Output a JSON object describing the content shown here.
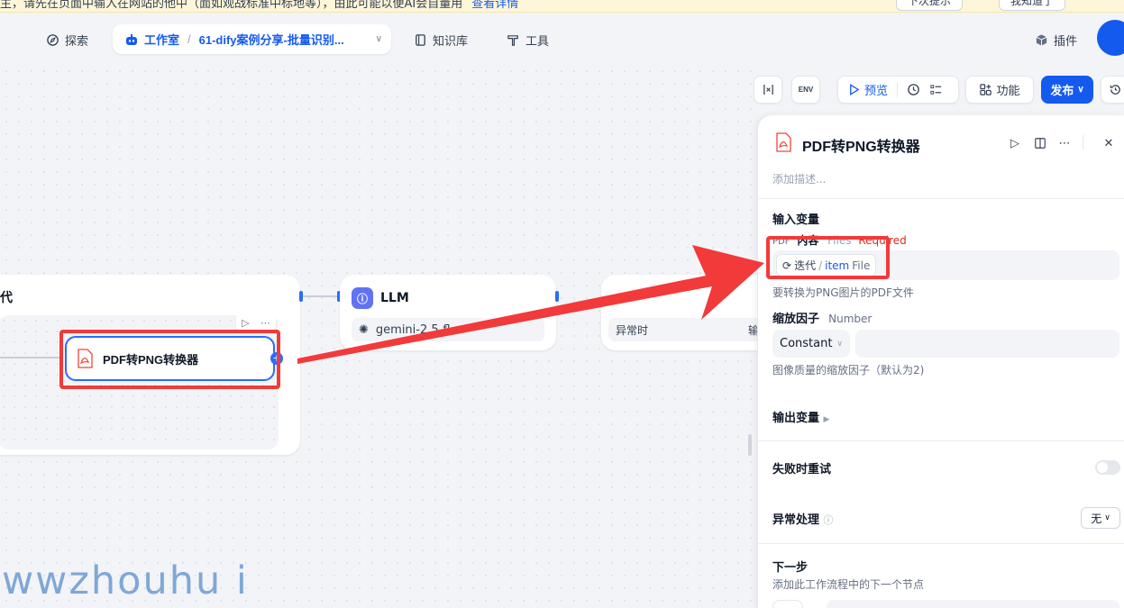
{
  "banner": {
    "text": "主，请先在页面中输入在网站的他中（面如观战标准中标地等），由此可能以便AI会自量用",
    "link": "查看详情",
    "btn1": "下次提示",
    "btn2": "我知道了"
  },
  "nav": {
    "explore": "探索",
    "studio": "工作室",
    "app_name": "61-dify案例分享-批量识别...",
    "knowledge": "知识库",
    "tools": "工具",
    "plugins": "插件"
  },
  "toolbar": {
    "env": "ENV",
    "preview": "预览",
    "features": "功能",
    "publish": "发布"
  },
  "canvas": {
    "iteration_title_fragment": "代",
    "pdf_node_label": "PDF转PNG转换器",
    "llm_title": "LLM",
    "llm_model": "gemini-2.5-fl",
    "node3_row_left": "异常时",
    "node3_row_right": "输"
  },
  "panel": {
    "title": "PDF转PNG转换器",
    "description_placeholder": "添加描述...",
    "input_vars_title": "输入变量",
    "content_label": "内容",
    "content_prefix": "PDF",
    "content_type": "Files",
    "content_required": "Required",
    "chip_scope": "迭代",
    "chip_item": "item",
    "chip_type": "File",
    "content_hint": "要转换为PNG图片的PDF文件",
    "scale_label": "缩放因子",
    "scale_type": "Number",
    "scale_mode": "Constant",
    "scale_hint": "图像质量的缩放因子（默认为2)",
    "output_vars": "输出变量",
    "retry_label": "失败时重试",
    "error_label": "异常处理",
    "error_value": "无",
    "next_title": "下一步",
    "next_hint": "添加此工作流程中的下一个节点"
  },
  "watermark": "wwzhouhu i",
  "colors": {
    "accent": "#155aef",
    "annotation": "#f23a3a",
    "node_border": "#296dff"
  }
}
